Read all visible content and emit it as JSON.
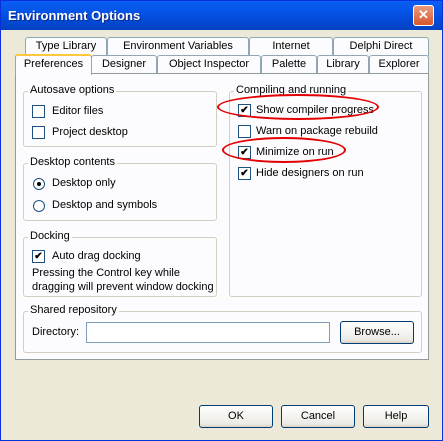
{
  "window": {
    "title": "Environment Options",
    "close_glyph": "✕"
  },
  "tabs_row1": [
    {
      "label": "Type Library"
    },
    {
      "label": "Environment Variables"
    },
    {
      "label": "Internet"
    },
    {
      "label": "Delphi Direct"
    }
  ],
  "tabs_row2": [
    {
      "label": "Preferences",
      "active": true
    },
    {
      "label": "Designer"
    },
    {
      "label": "Object Inspector"
    },
    {
      "label": "Palette"
    },
    {
      "label": "Library"
    },
    {
      "label": "Explorer"
    }
  ],
  "autosave": {
    "title": "Autosave options",
    "editor_files": "Editor files",
    "project_desktop": "Project desktop"
  },
  "desktop_contents": {
    "title": "Desktop contents",
    "desktop_only": "Desktop only",
    "desktop_and_symbols": "Desktop and symbols"
  },
  "docking": {
    "title": "Docking",
    "auto_drag": "Auto drag docking",
    "note_line1": "Pressing the Control key while",
    "note_line2": "dragging will prevent window docking"
  },
  "compiling": {
    "title": "Compiling and running",
    "show_progress": "Show compiler progress",
    "warn_rebuild": "Warn on package rebuild",
    "minimize": "Minimize on run",
    "hide_designers": "Hide designers on run"
  },
  "repository": {
    "title": "Shared repository",
    "directory_label": "Directory:",
    "directory_value": "",
    "browse": "Browse..."
  },
  "footer": {
    "ok": "OK",
    "cancel": "Cancel",
    "help": "Help"
  },
  "annotation_color": "#e30000"
}
